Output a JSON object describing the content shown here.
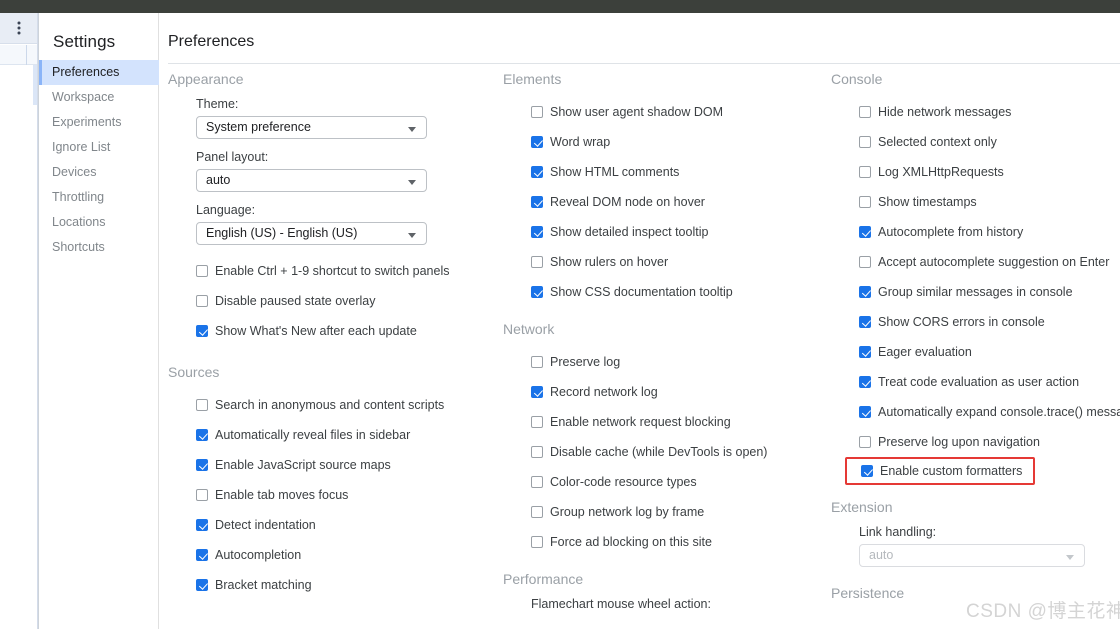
{
  "window": {
    "browser_band_color": "#3c403b",
    "accent_color": "#1a73e8",
    "selected_item_bg": "#d3e3fd",
    "highlight_box_color": "#e53935"
  },
  "left_strip": {
    "menu_icon": "more-vertical-icon"
  },
  "settings": {
    "title": "Settings",
    "nav_items": [
      {
        "label": "Preferences",
        "selected": true
      },
      {
        "label": "Workspace",
        "selected": false
      },
      {
        "label": "Experiments",
        "selected": false
      },
      {
        "label": "Ignore List",
        "selected": false
      },
      {
        "label": "Devices",
        "selected": false
      },
      {
        "label": "Throttling",
        "selected": false
      },
      {
        "label": "Locations",
        "selected": false
      },
      {
        "label": "Shortcuts",
        "selected": false
      }
    ]
  },
  "page": {
    "title": "Preferences"
  },
  "appearance": {
    "title": "Appearance",
    "theme_label": "Theme:",
    "theme_value": "System preference",
    "panel_layout_label": "Panel layout:",
    "panel_layout_value": "auto",
    "language_label": "Language:",
    "language_value": "English (US) - English (US)",
    "checkboxes": [
      {
        "label": "Enable Ctrl + 1-9 shortcut to switch panels",
        "checked": false
      },
      {
        "label": "Disable paused state overlay",
        "checked": false
      },
      {
        "label": "Show What's New after each update",
        "checked": true
      }
    ]
  },
  "sources": {
    "title": "Sources",
    "checkboxes": [
      {
        "label": "Search in anonymous and content scripts",
        "checked": false
      },
      {
        "label": "Automatically reveal files in sidebar",
        "checked": true
      },
      {
        "label": "Enable JavaScript source maps",
        "checked": true
      },
      {
        "label": "Enable tab moves focus",
        "checked": false
      },
      {
        "label": "Detect indentation",
        "checked": true
      },
      {
        "label": "Autocompletion",
        "checked": true
      },
      {
        "label": "Bracket matching",
        "checked": true
      }
    ]
  },
  "elements": {
    "title": "Elements",
    "checkboxes": [
      {
        "label": "Show user agent shadow DOM",
        "checked": false
      },
      {
        "label": "Word wrap",
        "checked": true
      },
      {
        "label": "Show HTML comments",
        "checked": true
      },
      {
        "label": "Reveal DOM node on hover",
        "checked": true
      },
      {
        "label": "Show detailed inspect tooltip",
        "checked": true
      },
      {
        "label": "Show rulers on hover",
        "checked": false
      },
      {
        "label": "Show CSS documentation tooltip",
        "checked": true
      }
    ]
  },
  "network": {
    "title": "Network",
    "checkboxes": [
      {
        "label": "Preserve log",
        "checked": false
      },
      {
        "label": "Record network log",
        "checked": true
      },
      {
        "label": "Enable network request blocking",
        "checked": false
      },
      {
        "label": "Disable cache (while DevTools is open)",
        "checked": false
      },
      {
        "label": "Color-code resource types",
        "checked": false
      },
      {
        "label": "Group network log by frame",
        "checked": false
      },
      {
        "label": "Force ad blocking on this site",
        "checked": false
      }
    ]
  },
  "performance": {
    "title": "Performance",
    "flamechart_label": "Flamechart mouse wheel action:"
  },
  "console": {
    "title": "Console",
    "checkboxes": [
      {
        "label": "Hide network messages",
        "checked": false,
        "highlight": false
      },
      {
        "label": "Selected context only",
        "checked": false,
        "highlight": false
      },
      {
        "label": "Log XMLHttpRequests",
        "checked": false,
        "highlight": false
      },
      {
        "label": "Show timestamps",
        "checked": false,
        "highlight": false
      },
      {
        "label": "Autocomplete from history",
        "checked": true,
        "highlight": false
      },
      {
        "label": "Accept autocomplete suggestion on Enter",
        "checked": false,
        "highlight": false
      },
      {
        "label": "Group similar messages in console",
        "checked": true,
        "highlight": false
      },
      {
        "label": "Show CORS errors in console",
        "checked": true,
        "highlight": false
      },
      {
        "label": "Eager evaluation",
        "checked": true,
        "highlight": false
      },
      {
        "label": "Treat code evaluation as user action",
        "checked": true,
        "highlight": false
      },
      {
        "label": "Automatically expand console.trace() messages",
        "checked": true,
        "highlight": false
      },
      {
        "label": "Preserve log upon navigation",
        "checked": false,
        "highlight": false
      },
      {
        "label": "Enable custom formatters",
        "checked": true,
        "highlight": true
      }
    ]
  },
  "extension": {
    "title": "Extension",
    "link_handling_label": "Link handling:",
    "link_handling_value": "auto"
  },
  "persistence": {
    "title": "Persistence"
  },
  "watermark": {
    "text": "CSDN @博主花神"
  }
}
